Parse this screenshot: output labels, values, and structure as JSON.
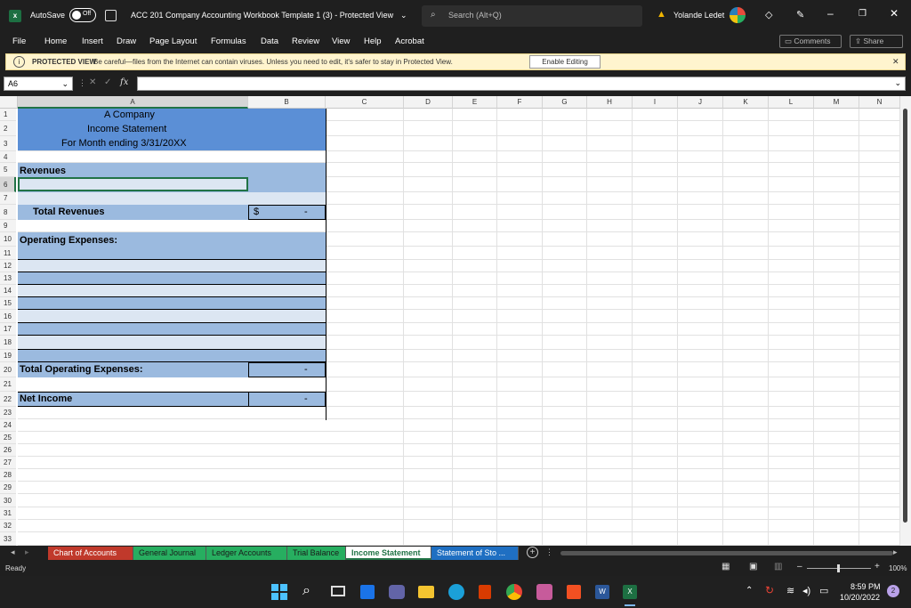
{
  "titlebar": {
    "autosave_label": "AutoSave",
    "autosave_state": "Off",
    "doc_title": "ACC 201 Company Accounting Workbook Template 1 (3)  -  Protected View",
    "search_placeholder": "Search (Alt+Q)",
    "user_name": "Yolande Ledet"
  },
  "menu": [
    "File",
    "Home",
    "Insert",
    "Draw",
    "Page Layout",
    "Formulas",
    "Data",
    "Review",
    "View",
    "Help",
    "Acrobat"
  ],
  "actions": {
    "comments": "Comments",
    "share": "Share"
  },
  "protected": {
    "title": "PROTECTED VIEW",
    "message": "Be careful—files from the Internet can contain viruses. Unless you need to edit, it's safer to stay in Protected View.",
    "button": "Enable Editing"
  },
  "formula_bar": {
    "name_box": "A6",
    "fx": "fx",
    "formula": ""
  },
  "columns": [
    "A",
    "B",
    "C",
    "D",
    "E",
    "F",
    "G",
    "H",
    "I",
    "J",
    "K",
    "L",
    "M",
    "N"
  ],
  "rows": [
    "1",
    "2",
    "3",
    "4",
    "5",
    "6",
    "7",
    "8",
    "9",
    "10",
    "11",
    "12",
    "13",
    "14",
    "15",
    "16",
    "17",
    "18",
    "19",
    "20",
    "21",
    "22",
    "23",
    "24",
    "25",
    "26",
    "27",
    "28",
    "29",
    "30",
    "31",
    "32",
    "33"
  ],
  "sheet": {
    "company": "A Company",
    "statement": "Income Statement",
    "period": "For Month ending 3/31/20XX",
    "revenues": "Revenues",
    "total_revenues": "Total Revenues",
    "total_revenues_currency": "$",
    "total_revenues_value": "-",
    "operating_expenses": "Operating Expenses:",
    "total_operating_expenses": "Total Operating Expenses:",
    "total_operating_expenses_value": "-",
    "net_income": "Net Income",
    "net_income_value": "-"
  },
  "tabs": [
    "Chart of Accounts",
    "General Journal",
    "Ledger Accounts",
    "Trial Balance",
    "Income Statement",
    "Statement of Sto ..."
  ],
  "active_tab": "Income Statement",
  "status": {
    "mode": "Ready",
    "zoom": "100%"
  },
  "clock": {
    "time": "8:59 PM",
    "date": "10/20/2022",
    "badge": "2"
  },
  "colors": {
    "header_blue": "#5b8fd6",
    "band_blue": "#9bbadf",
    "light_band": "#dce6f2",
    "tab_red": "#c0392b",
    "tab_green": "#27ae60"
  }
}
